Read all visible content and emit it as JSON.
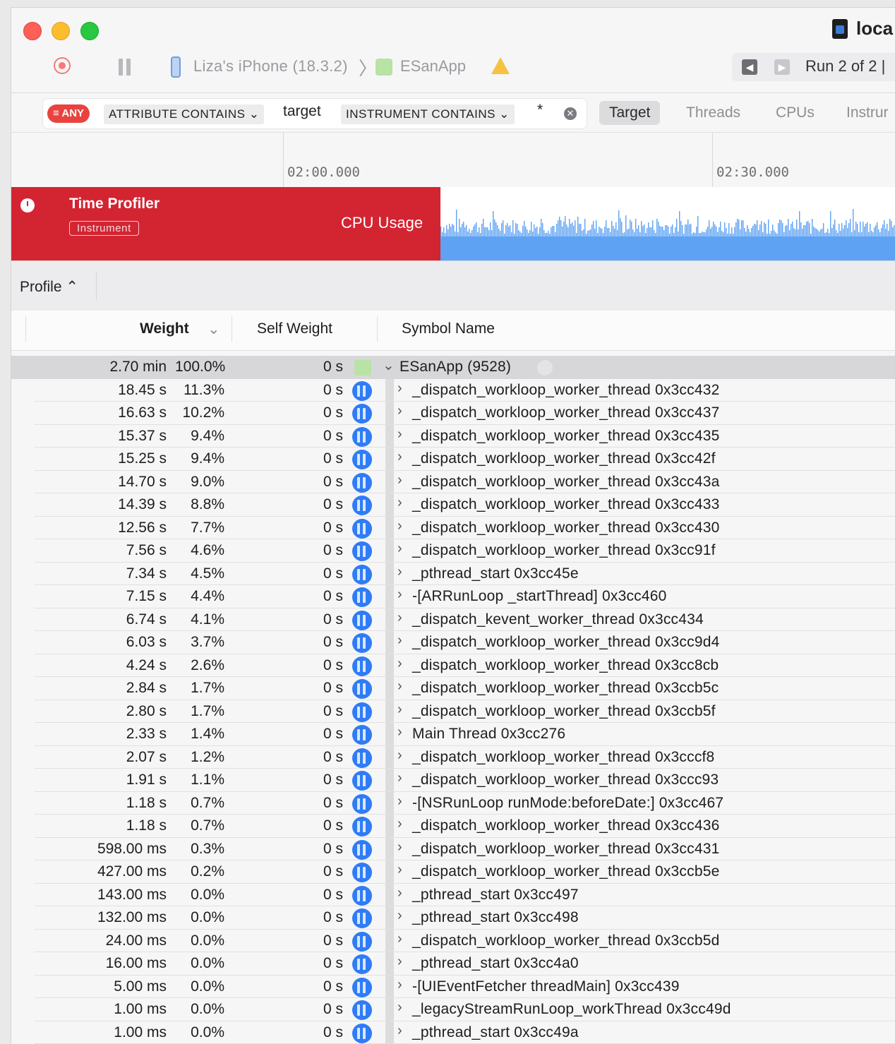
{
  "window": {
    "document_title": "loca",
    "device": "Liza's iPhone (18.3.2)",
    "app": "ESanApp",
    "run_label": "Run 2 of 2  |"
  },
  "filter": {
    "any_label": "≡ ANY",
    "token1": "ATTRIBUTE CONTAINS ⌄",
    "token1_value": "target",
    "token2": "INSTRUMENT CONTAINS ⌄",
    "token2_value": "*",
    "segments": [
      "Target",
      "Threads",
      "CPUs",
      "Instrur"
    ]
  },
  "timeline": {
    "ticks": [
      "02:00.000",
      "02:30.000"
    ]
  },
  "track": {
    "title": "Time Profiler",
    "badge": "Instrument",
    "graph_label": "CPU Usage",
    "color": "#d32432",
    "graph_color": "#5ea2f3"
  },
  "profile": {
    "selector": "Profile ⌃",
    "columns": {
      "weight": "Weight",
      "self_weight": "Self Weight",
      "symbol": "Symbol Name"
    }
  },
  "rows": [
    {
      "time": "2.70 min",
      "pct": "100.0%",
      "self": "0 s",
      "symbol": "ESanApp (9528)",
      "kind": "app"
    },
    {
      "time": "18.45 s",
      "pct": "11.3%",
      "self": "0 s",
      "symbol": "_dispatch_workloop_worker_thread  0x3cc432"
    },
    {
      "time": "16.63 s",
      "pct": "10.2%",
      "self": "0 s",
      "symbol": "_dispatch_workloop_worker_thread  0x3cc437"
    },
    {
      "time": "15.37 s",
      "pct": "9.4%",
      "self": "0 s",
      "symbol": "_dispatch_workloop_worker_thread  0x3cc435"
    },
    {
      "time": "15.25 s",
      "pct": "9.4%",
      "self": "0 s",
      "symbol": "_dispatch_workloop_worker_thread  0x3cc42f"
    },
    {
      "time": "14.70 s",
      "pct": "9.0%",
      "self": "0 s",
      "symbol": "_dispatch_workloop_worker_thread  0x3cc43a"
    },
    {
      "time": "14.39 s",
      "pct": "8.8%",
      "self": "0 s",
      "symbol": "_dispatch_workloop_worker_thread  0x3cc433"
    },
    {
      "time": "12.56 s",
      "pct": "7.7%",
      "self": "0 s",
      "symbol": "_dispatch_workloop_worker_thread  0x3cc430"
    },
    {
      "time": "7.56 s",
      "pct": "4.6%",
      "self": "0 s",
      "symbol": "_dispatch_workloop_worker_thread  0x3cc91f"
    },
    {
      "time": "7.34 s",
      "pct": "4.5%",
      "self": "0 s",
      "symbol": "_pthread_start  0x3cc45e"
    },
    {
      "time": "7.15 s",
      "pct": "4.4%",
      "self": "0 s",
      "symbol": "-[ARRunLoop _startThread]  0x3cc460"
    },
    {
      "time": "6.74 s",
      "pct": "4.1%",
      "self": "0 s",
      "symbol": "_dispatch_kevent_worker_thread  0x3cc434"
    },
    {
      "time": "6.03 s",
      "pct": "3.7%",
      "self": "0 s",
      "symbol": "_dispatch_workloop_worker_thread  0x3cc9d4"
    },
    {
      "time": "4.24 s",
      "pct": "2.6%",
      "self": "0 s",
      "symbol": "_dispatch_workloop_worker_thread  0x3cc8cb"
    },
    {
      "time": "2.84 s",
      "pct": "1.7%",
      "self": "0 s",
      "symbol": "_dispatch_workloop_worker_thread  0x3ccb5c"
    },
    {
      "time": "2.80 s",
      "pct": "1.7%",
      "self": "0 s",
      "symbol": "_dispatch_workloop_worker_thread  0x3ccb5f"
    },
    {
      "time": "2.33 s",
      "pct": "1.4%",
      "self": "0 s",
      "symbol": "Main Thread  0x3cc276"
    },
    {
      "time": "2.07 s",
      "pct": "1.2%",
      "self": "0 s",
      "symbol": "_dispatch_workloop_worker_thread  0x3cccf8"
    },
    {
      "time": "1.91 s",
      "pct": "1.1%",
      "self": "0 s",
      "symbol": "_dispatch_workloop_worker_thread  0x3ccc93"
    },
    {
      "time": "1.18 s",
      "pct": "0.7%",
      "self": "0 s",
      "symbol": "-[NSRunLoop runMode:beforeDate:]  0x3cc467"
    },
    {
      "time": "1.18 s",
      "pct": "0.7%",
      "self": "0 s",
      "symbol": "_dispatch_workloop_worker_thread  0x3cc436"
    },
    {
      "time": "598.00 ms",
      "pct": "0.3%",
      "self": "0 s",
      "symbol": "_dispatch_workloop_worker_thread  0x3cc431"
    },
    {
      "time": "427.00 ms",
      "pct": "0.2%",
      "self": "0 s",
      "symbol": "_dispatch_workloop_worker_thread  0x3ccb5e"
    },
    {
      "time": "143.00 ms",
      "pct": "0.0%",
      "self": "0 s",
      "symbol": "_pthread_start  0x3cc497"
    },
    {
      "time": "132.00 ms",
      "pct": "0.0%",
      "self": "0 s",
      "symbol": "_pthread_start  0x3cc498"
    },
    {
      "time": "24.00 ms",
      "pct": "0.0%",
      "self": "0 s",
      "symbol": "_dispatch_workloop_worker_thread  0x3ccb5d"
    },
    {
      "time": "16.00 ms",
      "pct": "0.0%",
      "self": "0 s",
      "symbol": "_pthread_start  0x3cc4a0"
    },
    {
      "time": "5.00 ms",
      "pct": "0.0%",
      "self": "0 s",
      "symbol": "-[UIEventFetcher threadMain]  0x3cc439"
    },
    {
      "time": "1.00 ms",
      "pct": "0.0%",
      "self": "0 s",
      "symbol": "_legacyStreamRunLoop_workThread  0x3cc49d"
    },
    {
      "time": "1.00 ms",
      "pct": "0.0%",
      "self": "0 s",
      "symbol": "_pthread_start  0x3cc49a"
    }
  ]
}
